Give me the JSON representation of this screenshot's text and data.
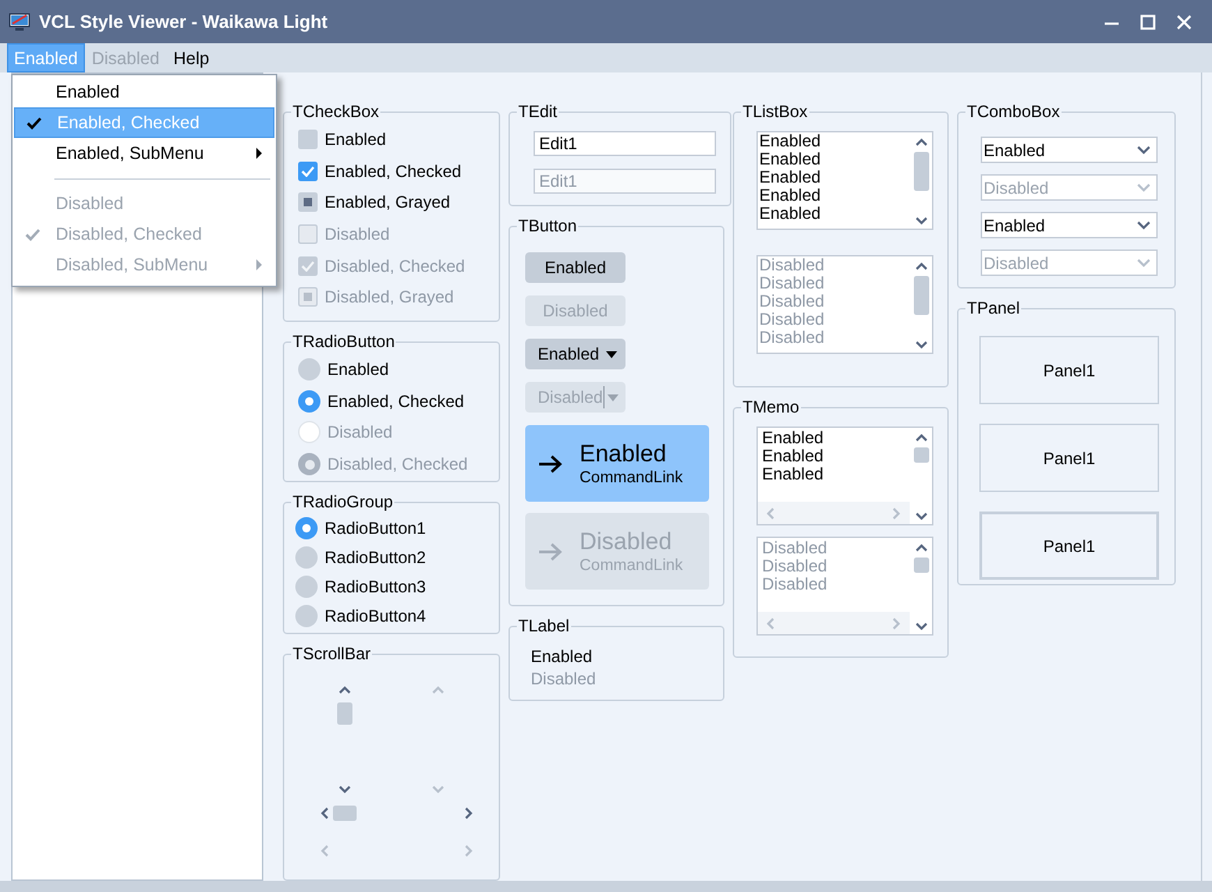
{
  "window": {
    "title": "VCL Style Viewer - Waikawa Light"
  },
  "menu_bar": [
    {
      "label": "Enabled",
      "selected": true,
      "disabled": false
    },
    {
      "label": "Disabled",
      "selected": false,
      "disabled": true
    },
    {
      "label": "Help",
      "selected": false,
      "disabled": false
    }
  ],
  "menu_dropdown": [
    {
      "kind": "item",
      "label": "Enabled",
      "checked": false,
      "disabled": false,
      "submenu": false,
      "selected": false
    },
    {
      "kind": "item",
      "label": "Enabled, Checked",
      "checked": true,
      "disabled": false,
      "submenu": false,
      "selected": true
    },
    {
      "kind": "item",
      "label": "Enabled, SubMenu",
      "checked": false,
      "disabled": false,
      "submenu": true,
      "selected": false
    },
    {
      "kind": "separator"
    },
    {
      "kind": "item",
      "label": "Disabled",
      "checked": false,
      "disabled": true,
      "submenu": false,
      "selected": false
    },
    {
      "kind": "item",
      "label": "Disabled, Checked",
      "checked": true,
      "disabled": true,
      "submenu": false,
      "selected": false
    },
    {
      "kind": "item",
      "label": "Disabled, SubMenu",
      "checked": false,
      "disabled": true,
      "submenu": true,
      "selected": false
    }
  ],
  "check_box_group": {
    "title": "TCheckBox",
    "items": [
      {
        "label": "Enabled",
        "checked": false,
        "grayed": false,
        "disabled": false
      },
      {
        "label": "Enabled, Checked",
        "checked": true,
        "grayed": false,
        "disabled": false
      },
      {
        "label": "Enabled, Grayed",
        "checked": false,
        "grayed": true,
        "disabled": false
      },
      {
        "label": "Disabled",
        "checked": false,
        "grayed": false,
        "disabled": true
      },
      {
        "label": "Disabled, Checked",
        "checked": true,
        "grayed": false,
        "disabled": true
      },
      {
        "label": "Disabled, Grayed",
        "checked": false,
        "grayed": true,
        "disabled": true
      }
    ]
  },
  "radio_button_group": {
    "title": "TRadioButton",
    "items": [
      {
        "label": "Enabled",
        "checked": false,
        "disabled": false
      },
      {
        "label": "Enabled, Checked",
        "checked": true,
        "disabled": false
      },
      {
        "label": "Disabled",
        "checked": false,
        "disabled": true
      },
      {
        "label": "Disabled, Checked",
        "checked": true,
        "disabled": true
      }
    ]
  },
  "radio_group": {
    "title": "TRadioGroup",
    "items": [
      {
        "label": "RadioButton1",
        "selected": true
      },
      {
        "label": "RadioButton2",
        "selected": false
      },
      {
        "label": "RadioButton3",
        "selected": false
      },
      {
        "label": "RadioButton4",
        "selected": false
      }
    ]
  },
  "scroll_bar_group": {
    "title": "TScrollBar",
    "bars": [
      {
        "kind": "vertical",
        "disabled": false
      },
      {
        "kind": "vertical",
        "disabled": true
      },
      {
        "kind": "horizontal",
        "disabled": false
      },
      {
        "kind": "horizontal",
        "disabled": true
      }
    ]
  },
  "edit_group": {
    "title": "TEdit",
    "fields": [
      {
        "value": "Edit1",
        "disabled": false
      },
      {
        "value": "Edit1",
        "disabled": true
      }
    ]
  },
  "button_group": {
    "title": "TButton",
    "buttons": [
      {
        "kind": "button",
        "label": "Enabled",
        "disabled": false
      },
      {
        "kind": "button",
        "label": "Disabled",
        "disabled": true
      },
      {
        "kind": "split",
        "label": "Enabled",
        "disabled": false
      },
      {
        "kind": "split",
        "label": "Disabled",
        "disabled": true
      },
      {
        "kind": "command_link",
        "label": "Enabled",
        "note": "CommandLink",
        "disabled": false
      },
      {
        "kind": "command_link",
        "label": "Disabled",
        "note": "CommandLink",
        "disabled": true
      }
    ]
  },
  "label_group": {
    "title": "TLabel",
    "labels": [
      {
        "text": "Enabled",
        "disabled": false
      },
      {
        "text": "Disabled",
        "disabled": true
      }
    ]
  },
  "list_box_group": {
    "title": "TListBox",
    "lists": [
      {
        "items": [
          "Enabled",
          "Enabled",
          "Enabled",
          "Enabled",
          "Enabled"
        ],
        "disabled": false
      },
      {
        "items": [
          "Disabled",
          "Disabled",
          "Disabled",
          "Disabled",
          "Disabled"
        ],
        "disabled": true
      }
    ]
  },
  "memo_group": {
    "title": "TMemo",
    "memos": [
      {
        "lines": [
          "Enabled",
          "Enabled",
          "Enabled"
        ],
        "disabled": false
      },
      {
        "lines": [
          "Disabled",
          "Disabled",
          "Disabled"
        ],
        "disabled": true
      }
    ]
  },
  "combo_box_group": {
    "title": "TComboBox",
    "combos": [
      {
        "value": "Enabled",
        "disabled": false
      },
      {
        "value": "Disabled",
        "disabled": true
      },
      {
        "value": "Enabled",
        "disabled": false
      },
      {
        "value": "Disabled",
        "disabled": true
      }
    ]
  },
  "panel_group": {
    "title": "TPanel",
    "panels": [
      {
        "label": "Panel1",
        "thick_border": false
      },
      {
        "label": "Panel1",
        "thick_border": false
      },
      {
        "label": "Panel1",
        "thick_border": true
      }
    ]
  }
}
